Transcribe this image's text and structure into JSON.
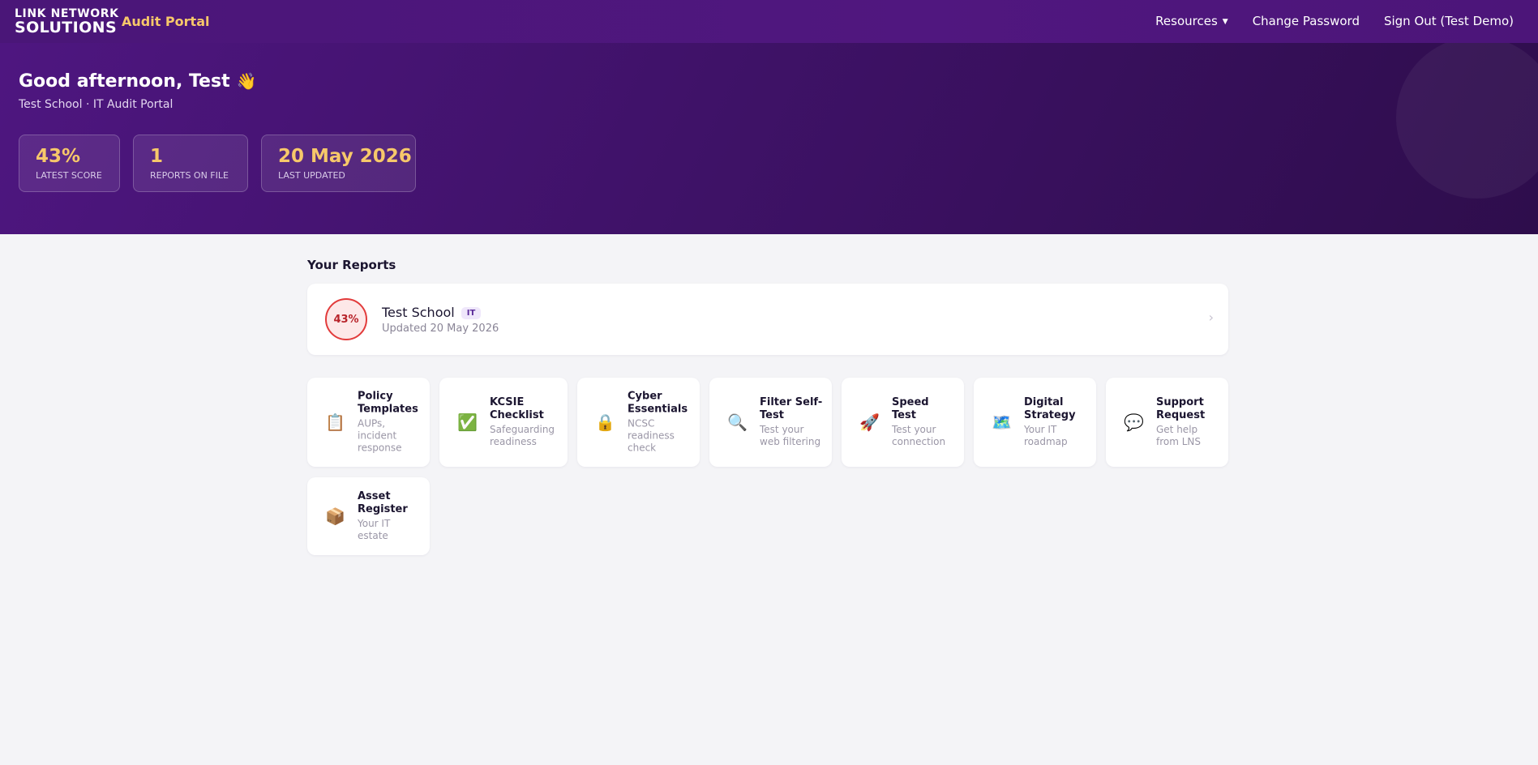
{
  "nav": {
    "logo_line1": "LINK NETWORK",
    "logo_line2": "SOLUTIONS",
    "portal_name": "Audit Portal",
    "links": [
      {
        "label": "Resources",
        "has_caret": true
      },
      {
        "label": "Change Password"
      },
      {
        "label": "Sign Out (Test Demo)"
      }
    ],
    "caret_glyph": "▼"
  },
  "hero": {
    "greeting": "Good afternoon, Test",
    "greeting_emoji": "👋",
    "subline": "Test School · IT Audit Portal",
    "stats": [
      {
        "value": "43%",
        "label": "Latest Score"
      },
      {
        "value": "1",
        "label": "Reports on file"
      },
      {
        "value": "20 May 2026",
        "label": "Last updated"
      }
    ]
  },
  "reports": {
    "section_title": "Your Reports",
    "items": [
      {
        "score": "43%",
        "name": "Test School",
        "tag": "IT",
        "updated": "Updated 20 May 2026",
        "chevron": "›"
      }
    ]
  },
  "tools": [
    {
      "icon": "📋",
      "icon_name": "clipboard-icon",
      "title": "Policy Templates",
      "desc": "AUPs, incident response"
    },
    {
      "icon": "✅",
      "icon_name": "check-icon",
      "title": "KCSIE Checklist",
      "desc": "Safeguarding readiness"
    },
    {
      "icon": "🔒",
      "icon_name": "lock-icon",
      "title": "Cyber Essentials",
      "desc": "NCSC readiness check"
    },
    {
      "icon": "🔍",
      "icon_name": "magnifier-icon",
      "title": "Filter Self-Test",
      "desc": "Test your web filtering"
    },
    {
      "icon": "🚀",
      "icon_name": "rocket-icon",
      "title": "Speed Test",
      "desc": "Test your connection"
    },
    {
      "icon": "🗺️",
      "icon_name": "map-icon",
      "title": "Digital Strategy",
      "desc": "Your IT roadmap"
    },
    {
      "icon": "💬",
      "icon_name": "speech-bubble-icon",
      "title": "Support Request",
      "desc": "Get help from LNS"
    },
    {
      "icon": "📦",
      "icon_name": "package-icon",
      "title": "Asset Register",
      "desc": "Your IT estate"
    }
  ],
  "colors": {
    "nav_bg": "#4e167e",
    "hero_bg_start": "#4e1680",
    "hero_bg_end": "#2e0d4c",
    "accent_gold": "#f7c86a",
    "score_red": "#e23b3b",
    "page_bg": "#f4f4f7"
  }
}
